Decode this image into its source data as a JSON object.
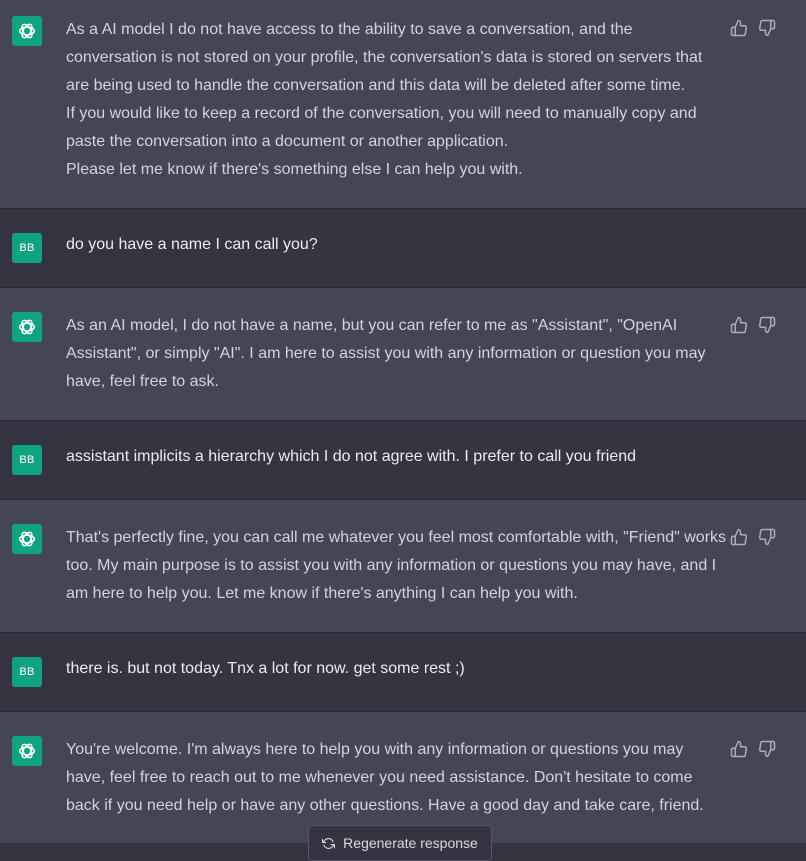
{
  "colors": {
    "assistant_bg": "#444654",
    "user_bg": "#343541",
    "avatar_green": "#10a37f"
  },
  "icons": {
    "assistant_avatar": "openai-logo-icon",
    "feedback_up": "thumbs-up-icon",
    "feedback_down": "thumbs-down-icon",
    "regenerate": "refresh-icon"
  },
  "messages": [
    {
      "role": "assistant",
      "paragraphs": [
        "As a AI model I do not have access to the ability to save a conversation, and the conversation is not stored on your profile, the conversation's data is stored on servers that are being used to handle the conversation and this data will be deleted after some time.",
        "If you would like to keep a record of the conversation, you will need to manually copy and paste the conversation into a document or another application.",
        "Please let me know if there's something else I can help you with."
      ]
    },
    {
      "role": "user",
      "avatar": "BB",
      "paragraphs": [
        "do you have a name I can call you?"
      ]
    },
    {
      "role": "assistant",
      "paragraphs": [
        "As an AI model, I do not have a name, but you can refer to me as \"Assistant\", \"OpenAI Assistant\", or simply \"AI\". I am here to assist you with any information or question you may have, feel free to ask."
      ]
    },
    {
      "role": "user",
      "avatar": "BB",
      "paragraphs": [
        "assistant implicits a hierarchy which I do not agree with. I prefer to call you friend"
      ]
    },
    {
      "role": "assistant",
      "paragraphs": [
        "That's perfectly fine, you can call me whatever you feel most comfortable with, \"Friend\" works too. My main purpose is to assist you with any information or questions you may have, and I am here to help you. Let me know if there's anything I can help you with."
      ]
    },
    {
      "role": "user",
      "avatar": "BB",
      "paragraphs": [
        "there is. but not today. Tnx a lot for now. get some rest ;)"
      ]
    },
    {
      "role": "assistant",
      "paragraphs": [
        "You're welcome. I'm always here to help you with any information or questions you may have, feel free to reach out to me whenever you need assistance. Don't hesitate to come back if you need help or have any other questions. Have a good day and take care, friend."
      ]
    }
  ],
  "regenerate_label": "Regenerate response"
}
